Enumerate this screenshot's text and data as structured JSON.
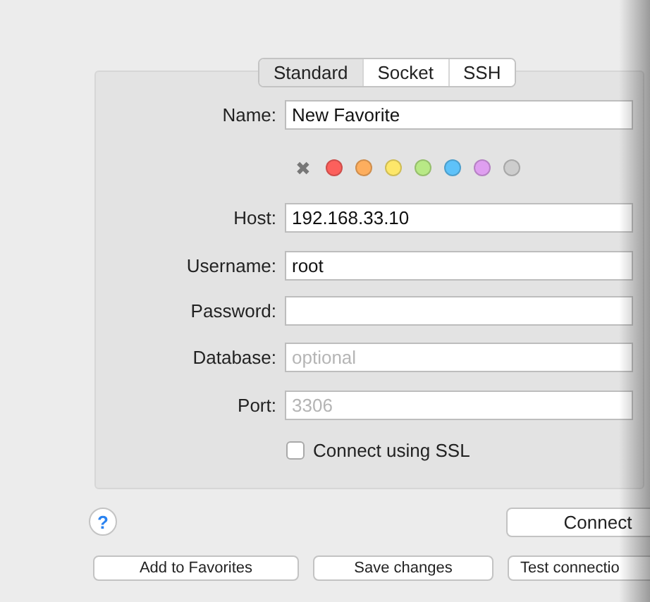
{
  "tabs": [
    {
      "label": "Standard",
      "selected": true
    },
    {
      "label": "Socket",
      "selected": false
    },
    {
      "label": "SSH",
      "selected": false
    }
  ],
  "name_field": {
    "label": "Name:",
    "value": "New Favorite"
  },
  "colors": [
    {
      "kind": "none",
      "glyph": "✖"
    },
    {
      "kind": "swatch",
      "color": "#fc605c"
    },
    {
      "kind": "swatch",
      "color": "#fdae5e"
    },
    {
      "kind": "swatch",
      "color": "#fde76a"
    },
    {
      "kind": "swatch",
      "color": "#b8e986"
    },
    {
      "kind": "swatch",
      "color": "#5ec2f9"
    },
    {
      "kind": "swatch",
      "color": "#df9ff0"
    },
    {
      "kind": "swatch",
      "color": "#cdcdcd"
    }
  ],
  "fields": [
    {
      "label": "Host:",
      "value": "192.168.33.10"
    },
    {
      "label": "Username:",
      "value": "root"
    },
    {
      "label": "Password:"
    },
    {
      "label": "Database:",
      "placeholder": "optional"
    },
    {
      "label": "Port:",
      "placeholder": "3306"
    }
  ],
  "ssl": {
    "label": "Connect using SSL",
    "checked": false
  },
  "help": {
    "glyph": "?"
  },
  "connect_button": "Connect",
  "buttons": [
    "Add to Favorites",
    "Save changes",
    "Test connectio"
  ]
}
